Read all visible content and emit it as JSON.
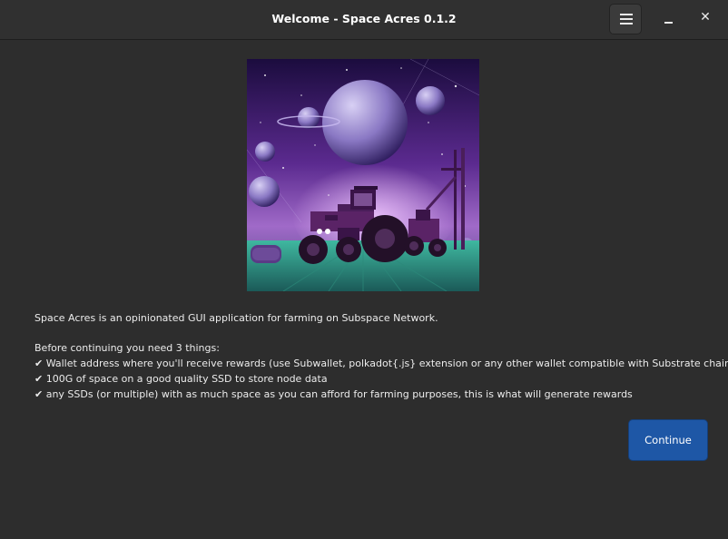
{
  "window": {
    "title": "Welcome - Space Acres 0.1.2",
    "icons": {
      "menu": "hamburger-menu-icon",
      "minimize": "minimize-icon",
      "close": "close-icon"
    },
    "close_glyph": "✕"
  },
  "content": {
    "intro": "Space Acres is an opinionated GUI application for farming on Subspace Network.",
    "requirements_heading": "Before continuing you need 3 things:",
    "requirements": [
      "✔ Wallet address where you'll receive rewards (use Subwallet, polkadot{.js} extension or any other wallet compatible with Substrate chain)",
      "✔ 100G of space on a good quality SSD to store node data",
      "✔ any SSDs (or multiple) with as much space as you can afford for farming purposes, this is what will generate rewards"
    ]
  },
  "actions": {
    "continue_label": "Continue"
  },
  "colors": {
    "accent": "#1e57a6",
    "background": "#2d2d2d",
    "titlebar": "#303030"
  }
}
